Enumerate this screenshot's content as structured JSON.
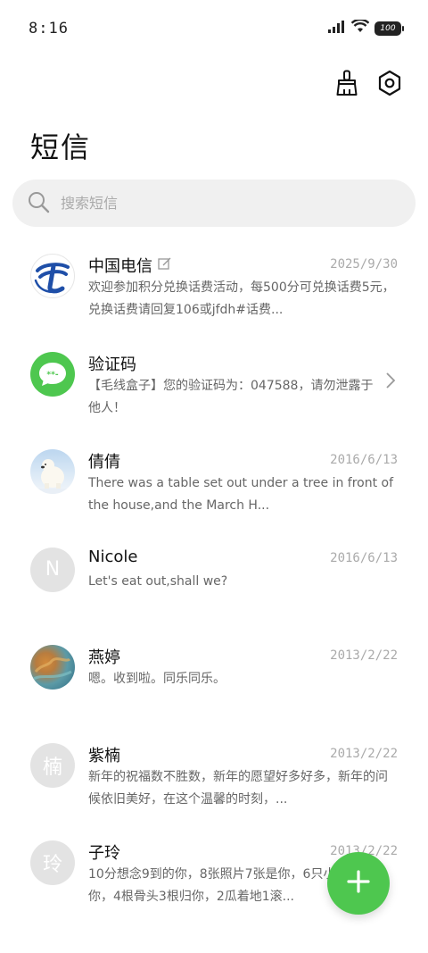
{
  "status": {
    "time": "8:16",
    "battery": "100"
  },
  "header": {
    "title": "短信"
  },
  "search": {
    "placeholder": "搜索短信"
  },
  "messages": [
    {
      "name": "中国电信",
      "date": "2025/9/30",
      "preview": "欢迎参加积分兑换话费活动，每500分可兑换话费5元，兑换话费请回复106或jfdh#话费..."
    },
    {
      "name": "验证码",
      "date": "",
      "preview": "【毛线盒子】您的验证码为：047588，请勿泄露于他人！"
    },
    {
      "name": "倩倩",
      "date": "2016/6/13",
      "preview": "There was a table set out under a tree in front of the house,and the March H..."
    },
    {
      "name": "Nicole",
      "date": "2016/6/13",
      "preview": "Let's eat out,shall we?",
      "avatar_letter": "N"
    },
    {
      "name": "燕婷",
      "date": "2013/2/22",
      "preview": "嗯。收到啦。同乐同乐。"
    },
    {
      "name": "紫楠",
      "date": "2013/2/22",
      "preview": "新年的祝福数不胜数，新年的愿望好多好多，新年的问候依旧美好，在这个温馨的时刻，...",
      "avatar_letter": "楠"
    },
    {
      "name": "子玲",
      "date": "2013/2/22",
      "preview": "10分想念9到的你，8张照片7张是你，6只小狗5只像你，4根骨头3根归你，2瓜着地1滚...",
      "avatar_letter": "玲"
    }
  ],
  "icons": {
    "clean": "broom-icon",
    "settings": "settings-hex-icon",
    "search": "search-icon",
    "fab": "plus-icon"
  },
  "colors": {
    "accent": "#4ec74f",
    "telecom_blue": "#1f4fa8"
  }
}
